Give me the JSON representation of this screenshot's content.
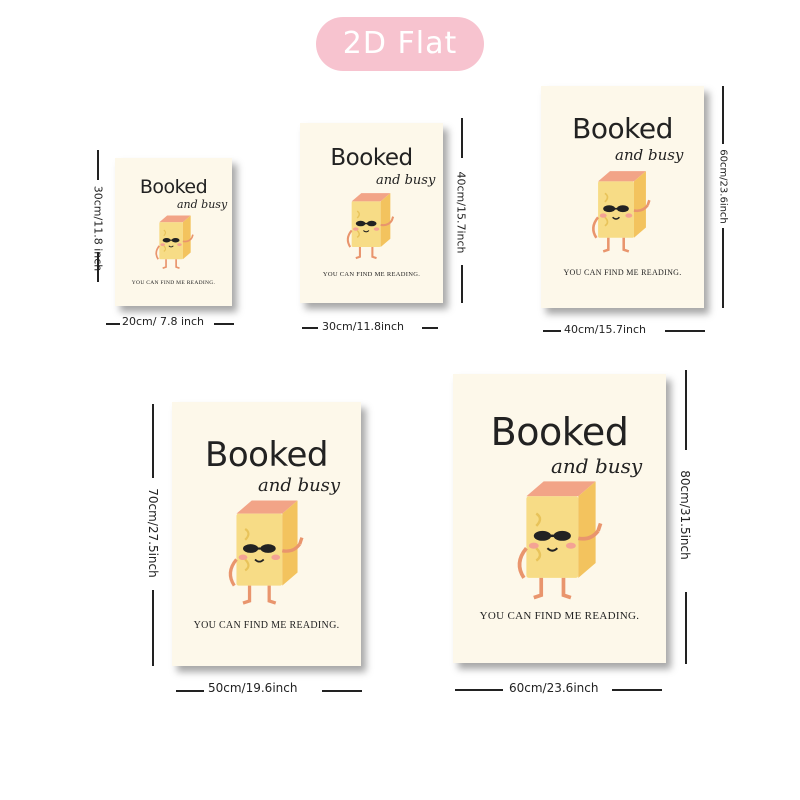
{
  "badge": "2D Flat",
  "poster": {
    "title": "Booked",
    "subtitle": "and busy",
    "tagline": "YOU CAN FIND ME READING."
  },
  "colors": {
    "badge_bg": "#f7c3cf",
    "poster_bg": "#fdf8ea",
    "book_body": "#f7dc86",
    "book_spine": "#f3c35e",
    "book_pages": "#f2a487",
    "limbs": "#e9956d"
  },
  "sizes": [
    {
      "width": "20cm/ 7.8 inch",
      "height": "30cm/11.8 inch"
    },
    {
      "width": "30cm/11.8inch",
      "height": "40cm/15.7inch"
    },
    {
      "width": "40cm/15.7inch",
      "height": "60cm/23.6inch"
    },
    {
      "width": "50cm/19.6inch",
      "height": "70cm/27.5inch"
    },
    {
      "width": "60cm/23.6inch",
      "height": "80cm/31.5inch"
    }
  ]
}
